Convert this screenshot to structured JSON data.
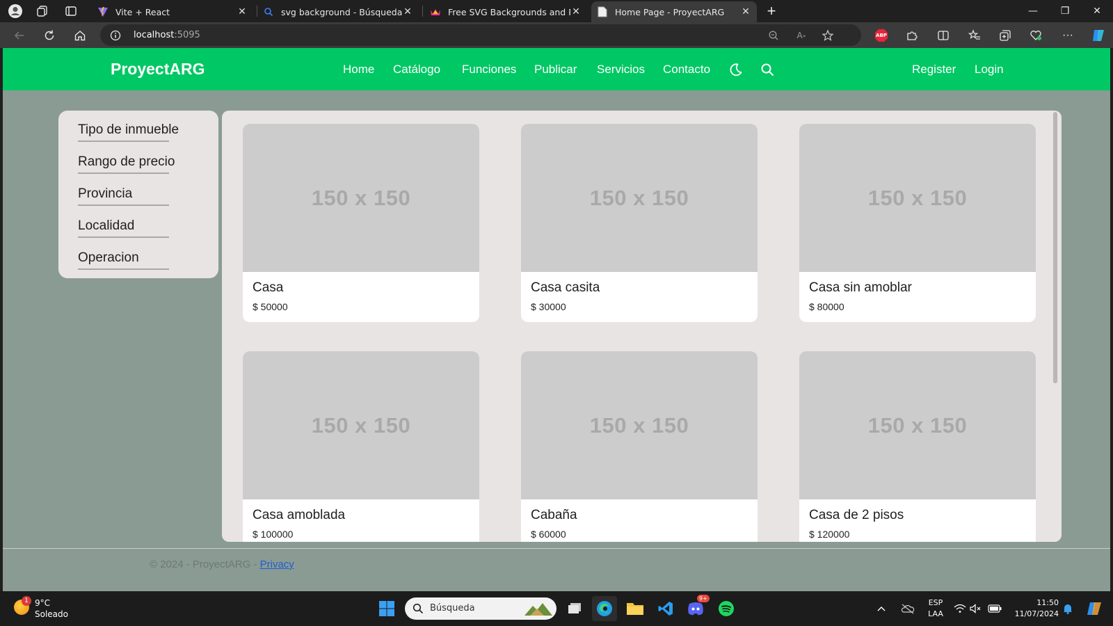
{
  "browser": {
    "tabs": [
      {
        "title": "Vite + React",
        "active": false
      },
      {
        "title": "svg background - Búsqueda",
        "active": false
      },
      {
        "title": "Free SVG Backgrounds and Patte",
        "active": false
      },
      {
        "title": "Home Page - ProyectARG",
        "active": true
      }
    ],
    "url_host": "localhost",
    "url_port": ":5095",
    "extension_label": "ABP"
  },
  "app": {
    "brand": "ProyectARG",
    "nav": {
      "home": "Home",
      "catalog": "Catálogo",
      "functions": "Funciones",
      "publish": "Publicar",
      "services": "Servicios",
      "contact": "Contacto",
      "register": "Register",
      "login": "Login"
    },
    "filters": [
      "Tipo de inmueble",
      "Rango de precio",
      "Provincia",
      "Localidad",
      "Operacion"
    ],
    "placeholder_text": "150 x 150",
    "listings": [
      {
        "name": "Casa",
        "price": "$ 50000"
      },
      {
        "name": "Casa casita",
        "price": "$ 30000"
      },
      {
        "name": "Casa sin amoblar",
        "price": "$ 80000"
      },
      {
        "name": "Casa amoblada",
        "price": "$ 100000"
      },
      {
        "name": "Cabaña",
        "price": "$ 60000"
      },
      {
        "name": "Casa de 2 pisos",
        "price": "$ 120000"
      }
    ],
    "footer": {
      "copyright": "© 2024 - ProyectARG - ",
      "privacy_link": "Privacy"
    }
  },
  "taskbar": {
    "weather": {
      "badge": "1",
      "temp": "9°C",
      "condition": "Soleado"
    },
    "search_placeholder": "Búsqueda",
    "discord_badge": "9+",
    "language": "ESP",
    "layout": "LAA",
    "time": "11:50",
    "date": "11/07/2024"
  },
  "colors": {
    "brand_green": "#00c864",
    "page_bg": "#8a9b93",
    "panel_bg": "#e8e4e3",
    "placeholder_bg": "#cccccc"
  }
}
